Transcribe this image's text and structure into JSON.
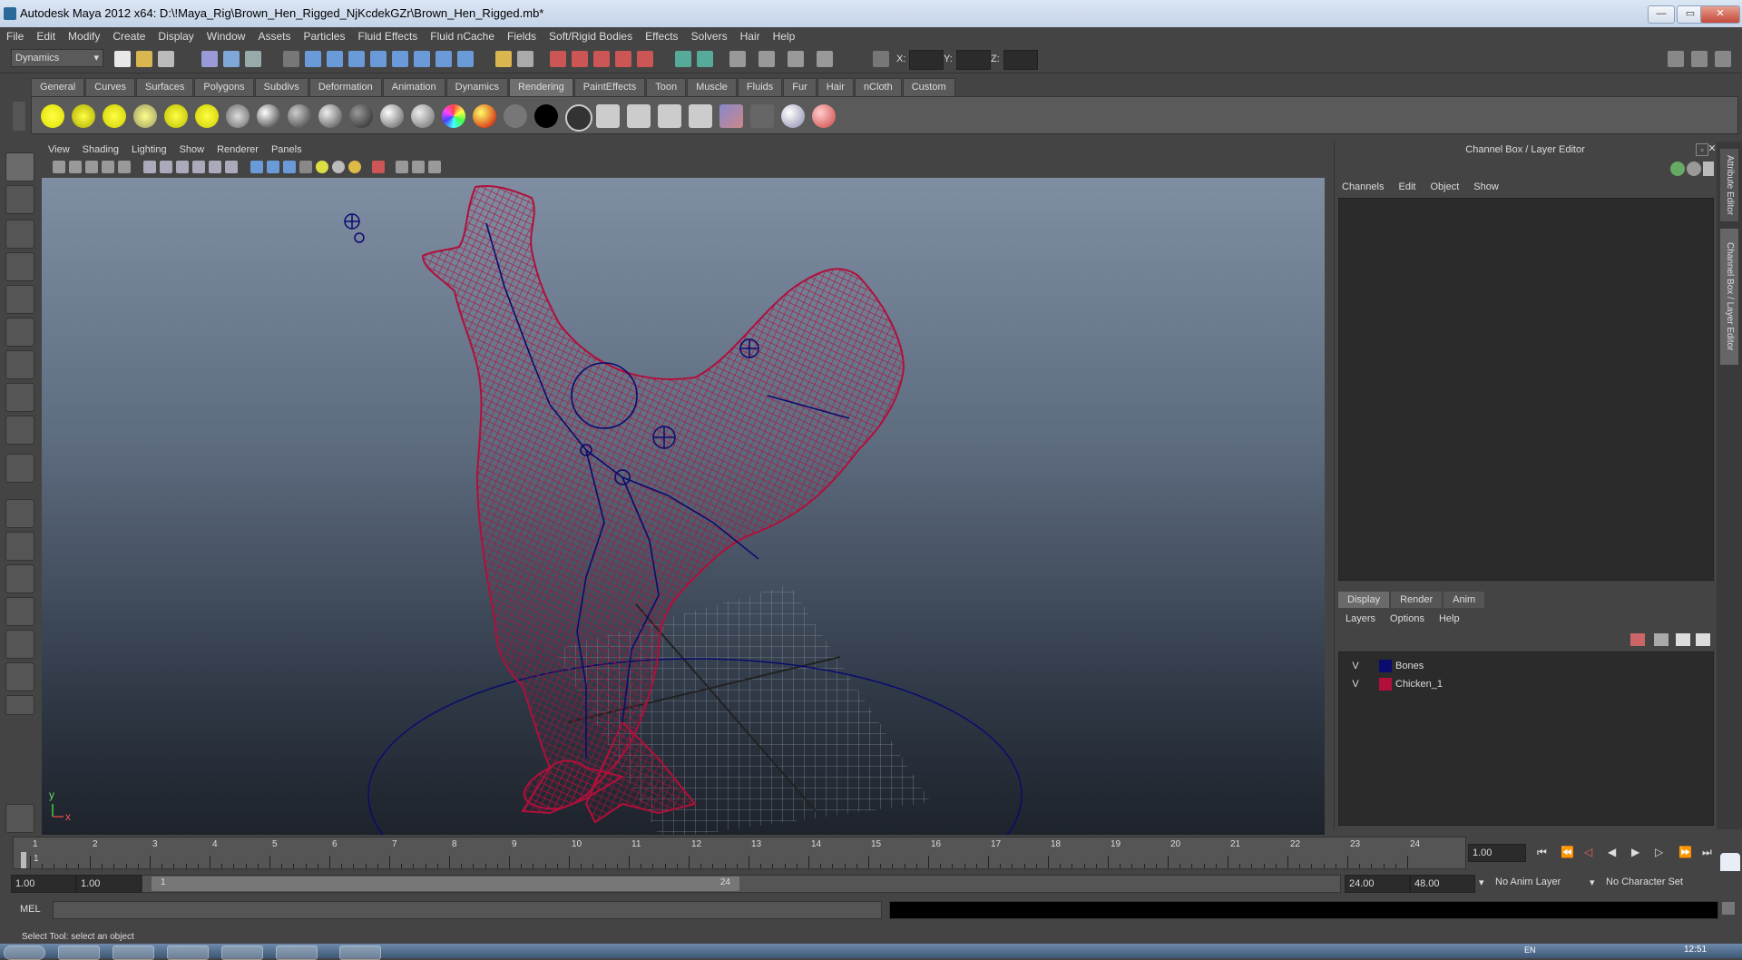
{
  "window": {
    "title": "Autodesk Maya 2012 x64: D:\\!Maya_Rig\\Brown_Hen_Rigged_NjKcdekGZr\\Brown_Hen_Rigged.mb*",
    "minimize": "—",
    "maximize": "▭",
    "close": "✕"
  },
  "menubar": [
    "File",
    "Edit",
    "Modify",
    "Create",
    "Display",
    "Window",
    "Assets",
    "Particles",
    "Fluid Effects",
    "Fluid nCache",
    "Fields",
    "Soft/Rigid Bodies",
    "Effects",
    "Solvers",
    "Hair",
    "Help"
  ],
  "statusline": {
    "mode": "Dynamics",
    "x_label": "X:",
    "y_label": "Y:",
    "z_label": "Z:"
  },
  "shelf": {
    "tabs": [
      "General",
      "Curves",
      "Surfaces",
      "Polygons",
      "Subdivs",
      "Deformation",
      "Animation",
      "Dynamics",
      "Rendering",
      "PaintEffects",
      "Toon",
      "Muscle",
      "Fluids",
      "Fur",
      "Hair",
      "nCloth",
      "Custom"
    ],
    "active_tab": "Rendering"
  },
  "viewport": {
    "menus": [
      "View",
      "Shading",
      "Lighting",
      "Show",
      "Renderer",
      "Panels"
    ],
    "axis_y": "y",
    "axis_x": "x"
  },
  "channelbox": {
    "title": "Channel Box / Layer Editor",
    "menus": [
      "Channels",
      "Edit",
      "Object",
      "Show"
    ],
    "layer_tabs": [
      "Display",
      "Render",
      "Anim"
    ],
    "layer_menus": [
      "Layers",
      "Options",
      "Help"
    ],
    "layers": [
      {
        "visible": "V",
        "name": "Bones",
        "color": "#0b0b6e"
      },
      {
        "visible": "V",
        "name": "Chicken_1",
        "color": "#b0103a"
      }
    ],
    "side_tab_1": "Attribute Editor",
    "side_tab_2": "Channel Box / Layer Editor"
  },
  "timeline": {
    "frames": [
      "1",
      "2",
      "3",
      "4",
      "5",
      "6",
      "7",
      "8",
      "9",
      "10",
      "11",
      "12",
      "13",
      "14",
      "15",
      "16",
      "17",
      "18",
      "19",
      "20",
      "21",
      "22",
      "23",
      "24"
    ],
    "current_frame": "1",
    "current_time": "1.00"
  },
  "range": {
    "start_time": "1.00",
    "playback_start": "1.00",
    "range_start": "1",
    "range_end": "24",
    "playback_end": "24.00",
    "end_time": "48.00",
    "anim_layer": "No Anim Layer",
    "character_set": "No Character Set"
  },
  "commandline": {
    "label": "MEL"
  },
  "helpline": {
    "text": "Select Tool: select an object"
  },
  "taskbar": {
    "clock": "12:51",
    "lang": "EN"
  },
  "colors": {
    "mesh": "#b0103a",
    "bones": "#0b0b6e",
    "accent": "#4a7ab0"
  }
}
